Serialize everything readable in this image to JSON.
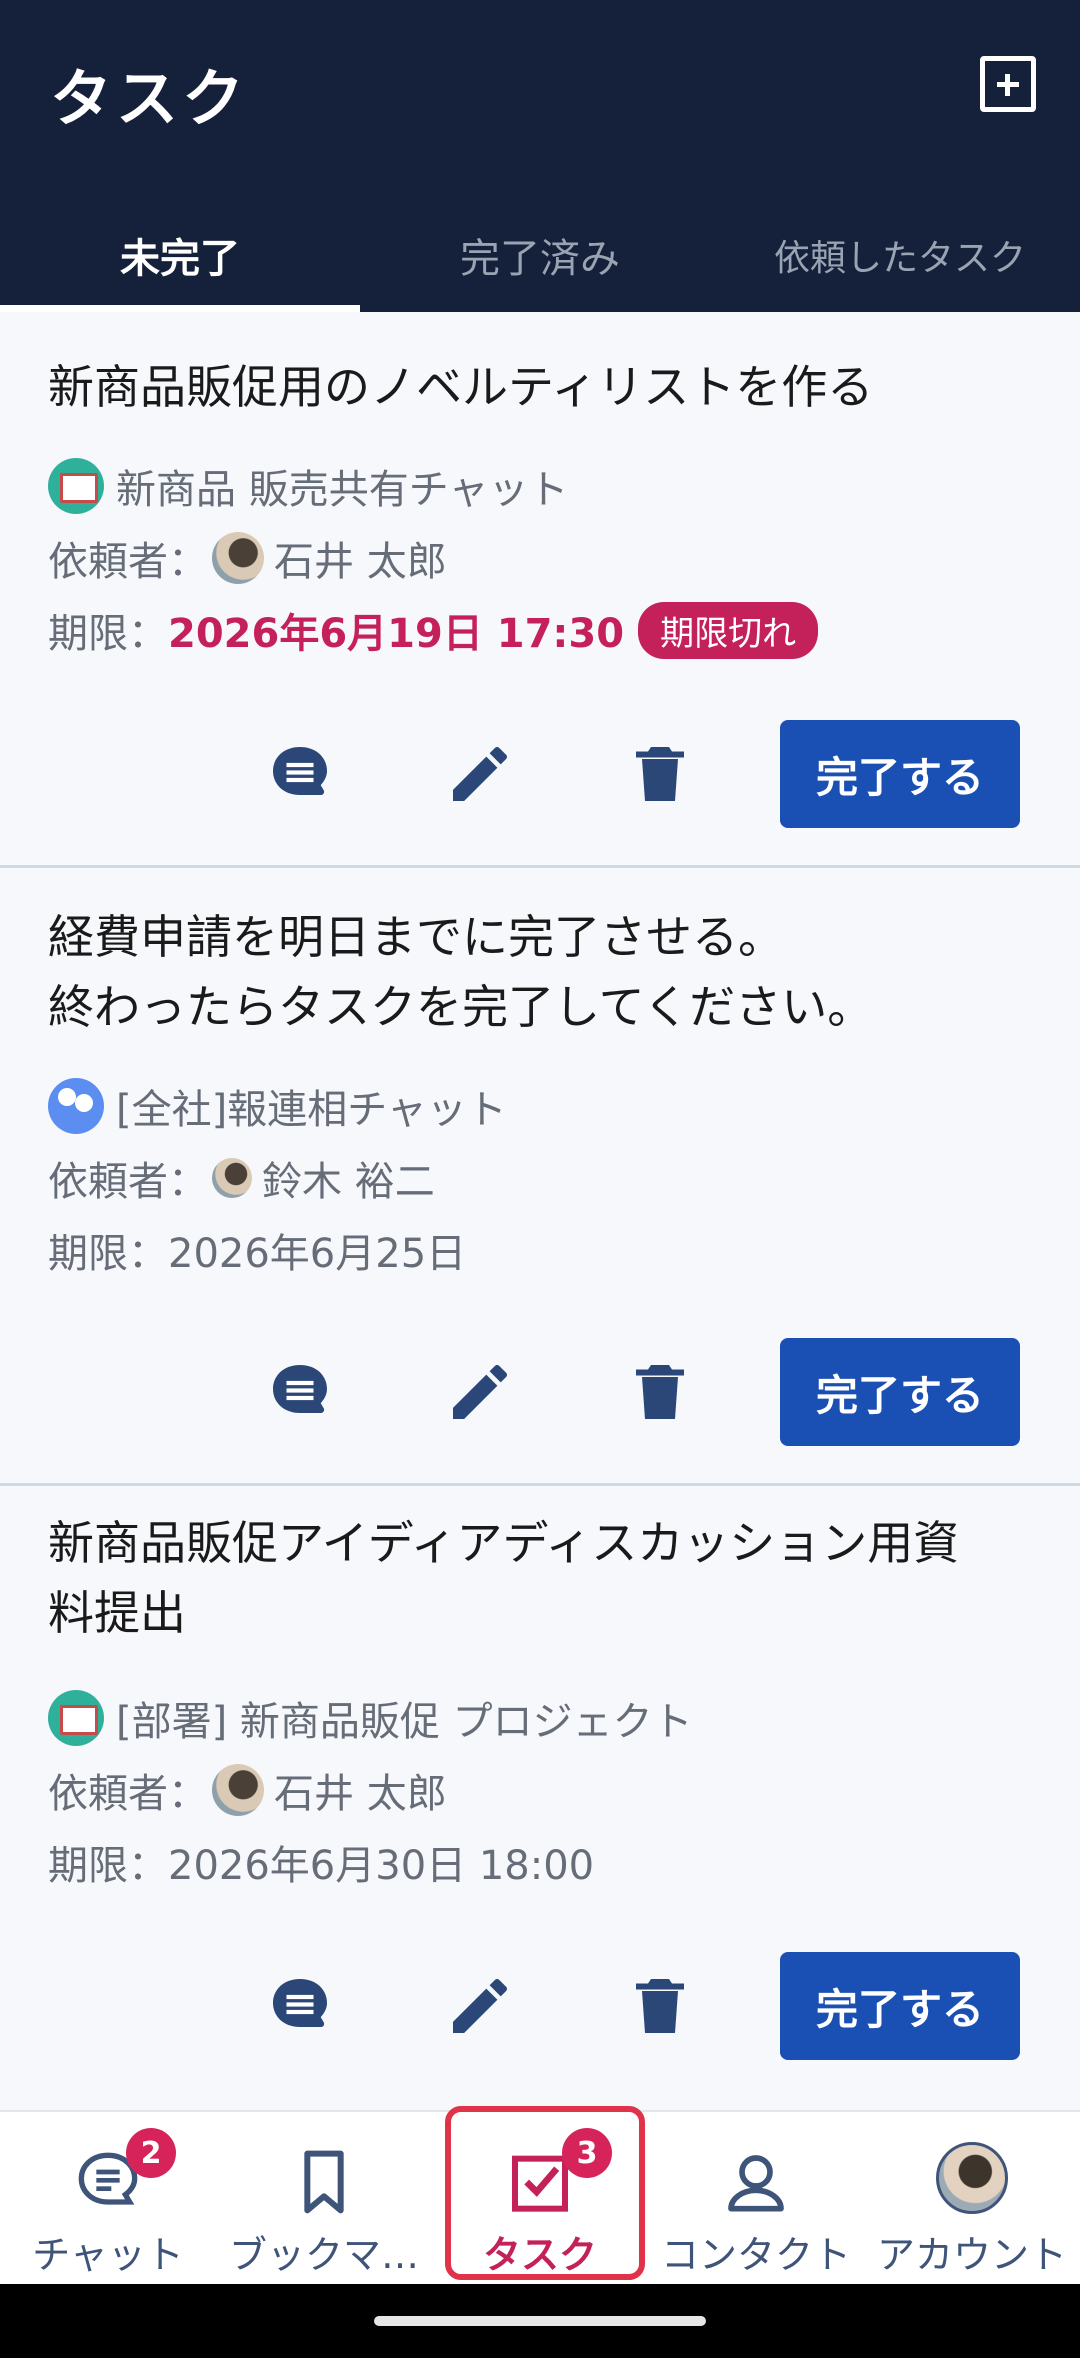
{
  "header": {
    "title": "タスク",
    "add_icon": "add-square-icon"
  },
  "tabs": [
    {
      "label": "未完了",
      "active": true
    },
    {
      "label": "完了済み",
      "active": false
    },
    {
      "label": "依頼したタスク",
      "active": false
    }
  ],
  "tasks": [
    {
      "title_lines": [
        "新商品販促用のノベルティリストを作る"
      ],
      "room": "新商品 販売共有チャット",
      "requester_label": "依頼者：",
      "requester": "石井 太郎",
      "deadline_label": "期限：",
      "deadline": "2026年6月19日 17:30",
      "overdue_badge": "期限切れ",
      "complete_label": "完了する"
    },
    {
      "title_lines": [
        "経費申請を明日までに完了させる。",
        "終わったらタスクを完了してください。"
      ],
      "room": "[全社]報連相チャット",
      "requester_label": "依頼者：",
      "requester": "鈴木 裕二",
      "deadline_label": "期限：",
      "deadline": "2026年6月25日",
      "complete_label": "完了する"
    },
    {
      "title_lines": [
        "新商品販促アイディアディスカッション用資",
        "料提出"
      ],
      "room": "[部署] 新商品販促 プロジェクト",
      "requester_label": "依頼者：",
      "requester": "石井 太郎",
      "deadline_label": "期限：",
      "deadline": "2026年6月30日 18:00",
      "complete_label": "完了する"
    }
  ],
  "bottom_nav": [
    {
      "label": "チャット",
      "icon": "chat-icon",
      "badge": "2"
    },
    {
      "label": "ブックマ…",
      "icon": "bookmark-icon"
    },
    {
      "label": "タスク",
      "icon": "task-check-icon",
      "badge": "3",
      "active": true
    },
    {
      "label": "コンタクト",
      "icon": "contact-icon"
    },
    {
      "label": "アカウント",
      "icon": "account-avatar"
    }
  ],
  "colors": {
    "header_bg": "#15203a",
    "primary_button": "#1a4fb4",
    "overdue": "#c4215a",
    "nav_text": "#3f5479"
  }
}
